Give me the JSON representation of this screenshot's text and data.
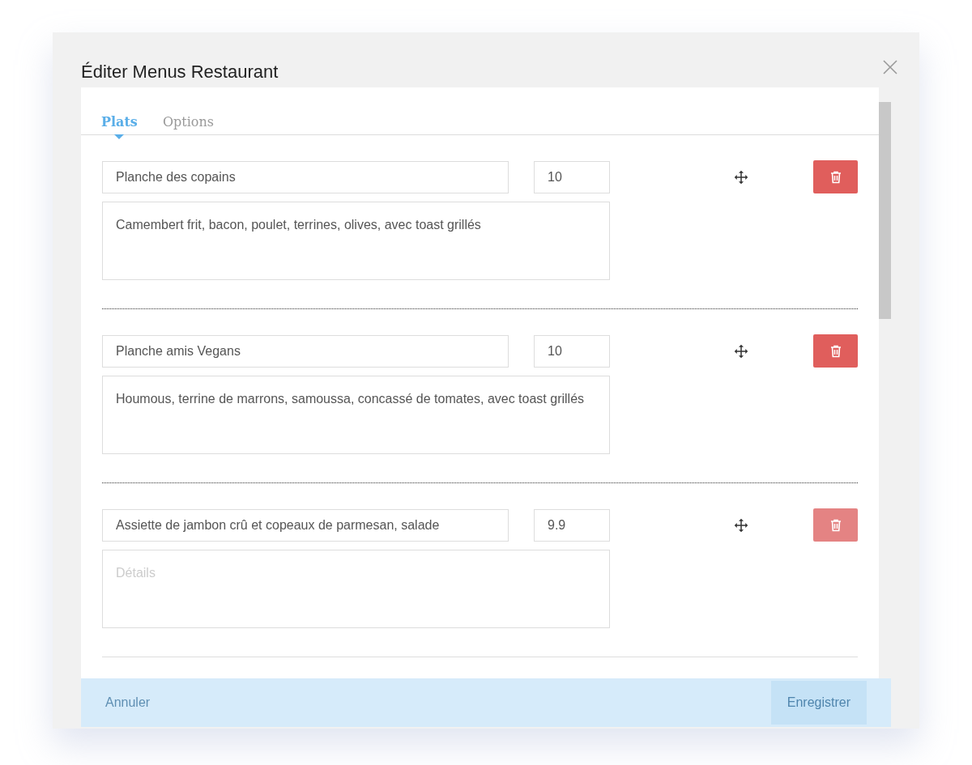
{
  "dialog": {
    "title": "Éditer Menus Restaurant"
  },
  "tabs": [
    {
      "label": "Plats",
      "selected": true
    },
    {
      "label": "Options",
      "selected": false
    }
  ],
  "dishes": [
    {
      "name": "Planche des copains",
      "price": "10",
      "details": "Camembert frit, bacon, poulet, terrines, olives, avec toast grillés",
      "dimmed": false
    },
    {
      "name": "Planche amis Vegans",
      "price": "10",
      "details": "Houmous, terrine de marrons, samoussa, concassé de tomates, avec toast grillés",
      "dimmed": false
    },
    {
      "name": "Assiette de jambon crû et copeaux de parmesan, salade",
      "price": "9.9",
      "details_placeholder": "Détails",
      "dimmed": true
    }
  ],
  "footer": {
    "cancel": "Annuler",
    "save": "Enregistrer"
  }
}
